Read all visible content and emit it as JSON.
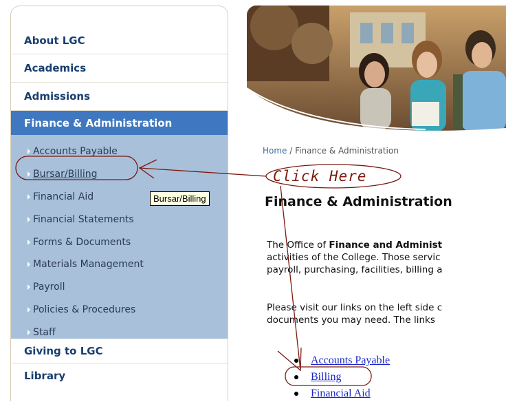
{
  "sidebar": {
    "items": [
      {
        "label": "About LGC"
      },
      {
        "label": "Academics"
      },
      {
        "label": "Admissions"
      },
      {
        "label": "Finance & Administration"
      },
      {
        "label": "Giving to LGC"
      },
      {
        "label": "Library"
      }
    ],
    "submenu": [
      {
        "label": "Accounts Payable"
      },
      {
        "label": "Bursar/Billing"
      },
      {
        "label": "Financial Aid"
      },
      {
        "label": "Financial Statements"
      },
      {
        "label": "Forms & Documents"
      },
      {
        "label": "Materials Management"
      },
      {
        "label": "Payroll"
      },
      {
        "label": "Policies & Procedures"
      },
      {
        "label": "Staff"
      }
    ]
  },
  "tooltip": {
    "text": "Bursar/Billing"
  },
  "annotation": {
    "text": "Click Here"
  },
  "breadcrumb": {
    "home": "Home",
    "separator": " / ",
    "current": "Finance & Administration"
  },
  "main": {
    "title": "Finance & Administration",
    "para1": {
      "line1_pre": "The Office of ",
      "line1_bold": "Finance and Administ",
      "line2": "activities of the College. Those servic",
      "line3": "payroll, purchasing, facilities, billing a"
    },
    "para2": {
      "line1": "Please visit our links on the left side c",
      "line2": "documents you may need.  The links"
    },
    "links": [
      {
        "label": "Accounts Payable"
      },
      {
        "label": "Billing"
      },
      {
        "label": "Financial Aid"
      }
    ]
  },
  "colors": {
    "nav_active_bg": "#3f78c0",
    "submenu_bg": "#a8c0da",
    "annotation": "#7a1a10",
    "link": "#1a26c9"
  }
}
